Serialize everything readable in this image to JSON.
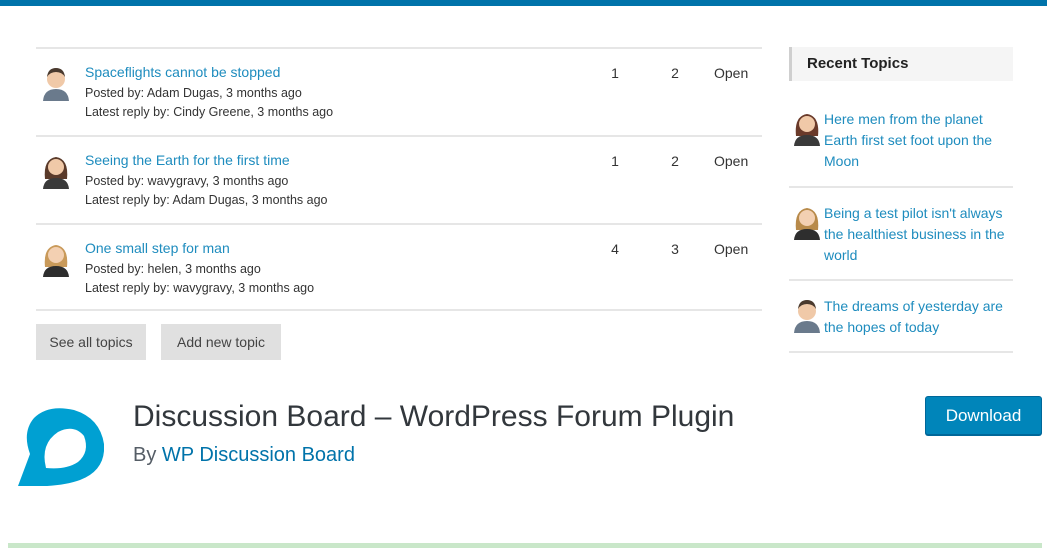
{
  "topics": [
    {
      "title": "Spaceflights cannot be stopped",
      "posted": "Posted by: Adam Dugas, 3 months ago",
      "reply": "Latest reply by: Cindy Greene, 3 months ago",
      "col1": "1",
      "col2": "2",
      "status": "Open",
      "avatar_icon": "male-avatar-icon"
    },
    {
      "title": "Seeing the Earth for the first time",
      "posted": "Posted by: wavygravy, 3 months ago",
      "reply": "Latest reply by: Adam Dugas, 3 months ago",
      "col1": "1",
      "col2": "2",
      "status": "Open",
      "avatar_icon": "female-avatar-icon"
    },
    {
      "title": "One small step for man",
      "posted": "Posted by: helen, 3 months ago",
      "reply": "Latest reply by: wavygravy, 3 months ago",
      "col1": "4",
      "col2": "3",
      "status": "Open",
      "avatar_icon": "female-avatar-icon"
    }
  ],
  "buttons": {
    "see_all": "See all topics",
    "add_new": "Add new topic"
  },
  "sidebar": {
    "heading": "Recent Topics",
    "items": [
      {
        "text": "Here men from the planet Earth first set foot upon the Moon",
        "avatar_icon": "female-avatar-icon"
      },
      {
        "text": "Being a test pilot isn't always the healthiest business in the world",
        "avatar_icon": "female-avatar-icon"
      },
      {
        "text": "The dreams of yesterday are the hopes of today",
        "avatar_icon": "male-avatar-icon"
      }
    ]
  },
  "plugin": {
    "title": "Discussion Board – WordPress Forum Plugin",
    "by": "By ",
    "author": "WP Discussion Board",
    "download_label": "Download",
    "icon": "discussion-board-logo-icon"
  },
  "colors": {
    "accent": "#0073aa",
    "link": "#1e8cbe",
    "download_button": "#0085ba",
    "logo": "#00a0d2",
    "success_bar": "#c9e7c9"
  }
}
